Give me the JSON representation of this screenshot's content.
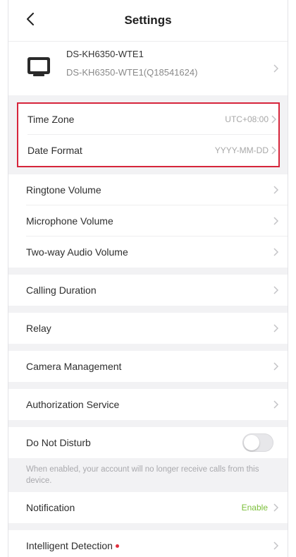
{
  "header": {
    "title": "Settings",
    "back_icon": "chevron-left-icon"
  },
  "device": {
    "name": "DS-KH6350-WTE1",
    "serial": "DS-KH6350-WTE1(Q18541624)",
    "icon": "monitor-icon"
  },
  "highlighted": {
    "time_zone": {
      "label": "Time Zone",
      "value": "UTC+08:00"
    },
    "date_format": {
      "label": "Date Format",
      "value": "YYYY-MM-DD"
    },
    "border_color": "#d6253b"
  },
  "volume": {
    "ringtone": "Ringtone Volume",
    "microphone": "Microphone Volume",
    "two_way": "Two-way Audio Volume"
  },
  "items": {
    "calling_duration": "Calling Duration",
    "relay": "Relay",
    "camera_management": "Camera Management",
    "authorization_service": "Authorization Service"
  },
  "dnd": {
    "label": "Do Not Disturb",
    "enabled": false,
    "note": "When enabled, your account will no longer receive calls from this device."
  },
  "notification": {
    "label": "Notification",
    "value": "Enable",
    "value_color": "#7cbf3a"
  },
  "intelligent_detection": {
    "label": "Intelligent Detection",
    "badge_color": "#e0303f"
  }
}
